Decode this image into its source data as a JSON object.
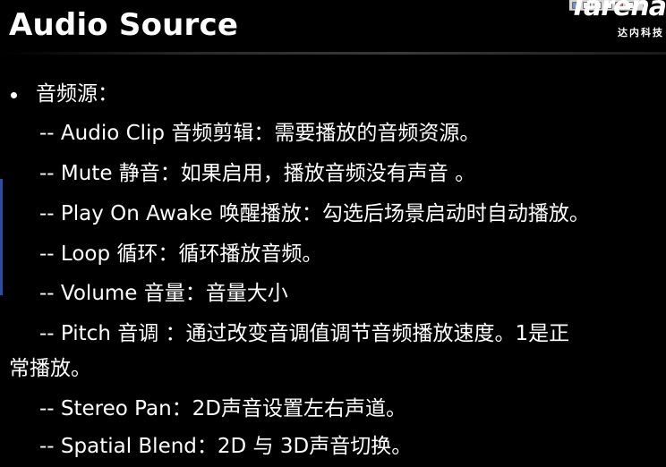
{
  "slide": {
    "title": "Audio Source",
    "logo": {
      "wordmark": "Tarena",
      "subtitle": "达内科技"
    },
    "bullet": {
      "label": "音频源："
    },
    "items": [
      "-- Audio Clip 音频剪辑：需要播放的音频资源。",
      "-- Mute 静音：如果启用，播放音频没有声音 。",
      "-- Play On Awake 唤醒播放：勾选后场景启动时自动播放。",
      "-- Loop 循环：循环播放音频。",
      "-- Volume 音量：音量大小",
      "-- Pitch 音调  ：通过改变音调值调节音频播放速度。1是正",
      "常播放。",
      "-- Stereo Pan：2D声音设置左右声道。",
      "-- Spatial Blend：2D 与 3D声音切换。"
    ]
  },
  "colors": {
    "background": "#000000",
    "text": "#ffffff",
    "accent": "#2a4ea8"
  },
  "icons": [
    "toolbar-icons"
  ]
}
